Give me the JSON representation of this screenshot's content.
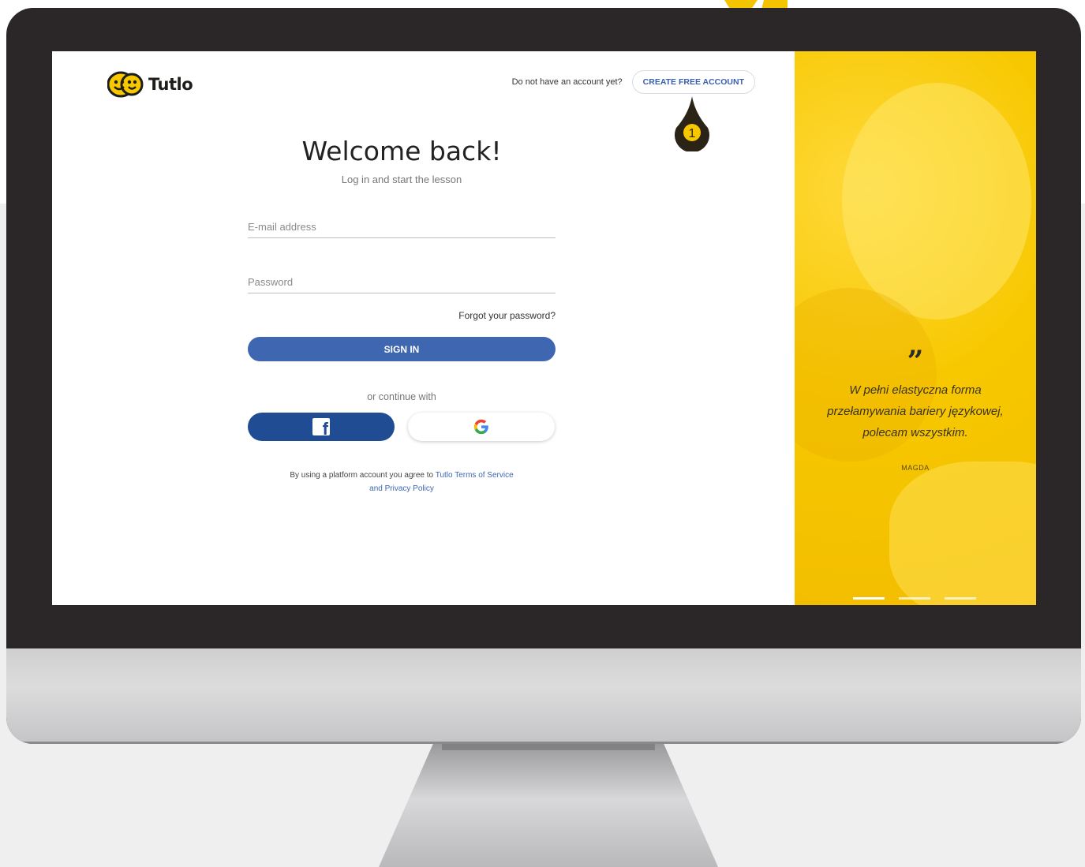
{
  "brand": {
    "name": "Tutlo",
    "accent": "#f7c800",
    "primary": "#3f67b1",
    "facebook": "#1f4c93"
  },
  "header": {
    "no_account_text": "Do not have an account yet?",
    "create_account_label": "CREATE FREE ACCOUNT",
    "step_number": "1"
  },
  "login": {
    "title": "Welcome back!",
    "subtitle": "Log in and start the lesson",
    "email_placeholder": "E-mail address",
    "password_placeholder": "Password",
    "forgot_label": "Forgot your password?",
    "signin_label": "SIGN IN",
    "continue_with": "or continue with",
    "terms_prefix": "By using a platform account you agree to",
    "terms_link1": "Tutlo Terms of Service",
    "terms_link2": "and Privacy Policy"
  },
  "social": {
    "facebook_icon": "facebook-icon",
    "google_icon": "google-icon"
  },
  "testimonial": {
    "quote_mark": "”",
    "quote": "W pełni elastyczna forma przełamywania bariery językowej, polecam wszystkim.",
    "author": "MAGDA",
    "slides": 3,
    "active_slide": 1
  }
}
